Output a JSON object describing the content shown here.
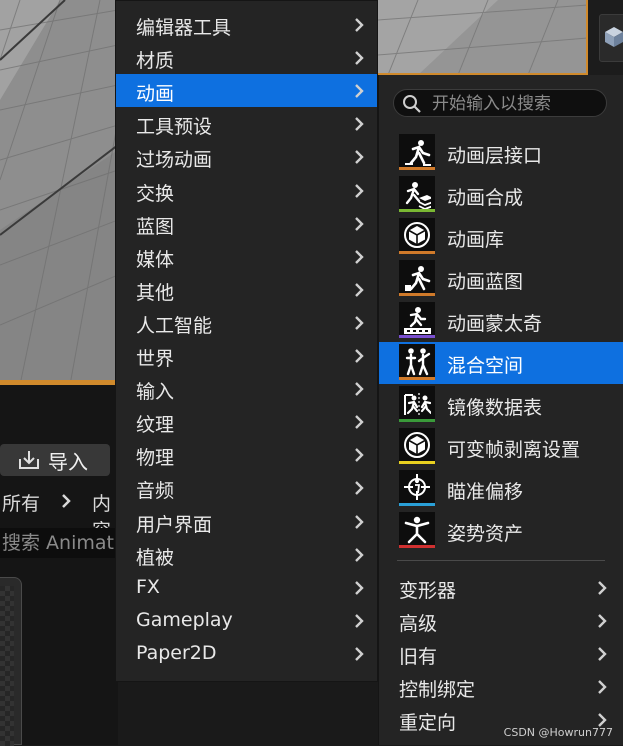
{
  "colors": {
    "selection": "#0e70e0",
    "menu_background": "#242424",
    "viewport_border": "#d08a2c"
  },
  "background": {
    "import_button": {
      "label": "导入",
      "icon": "import-icon"
    },
    "breadcrumb": {
      "root": "所有",
      "separator": "chevron-right-icon",
      "next": "内容"
    },
    "search": {
      "value": "搜索 Animation"
    }
  },
  "main_menu": {
    "items": [
      {
        "label": "编辑器工具",
        "selected": false
      },
      {
        "label": "材质",
        "selected": false
      },
      {
        "label": "动画",
        "selected": true
      },
      {
        "label": "工具预设",
        "selected": false
      },
      {
        "label": "过场动画",
        "selected": false
      },
      {
        "label": "交换",
        "selected": false
      },
      {
        "label": "蓝图",
        "selected": false
      },
      {
        "label": "媒体",
        "selected": false
      },
      {
        "label": "其他",
        "selected": false
      },
      {
        "label": "人工智能",
        "selected": false
      },
      {
        "label": "世界",
        "selected": false
      },
      {
        "label": "输入",
        "selected": false
      },
      {
        "label": "纹理",
        "selected": false
      },
      {
        "label": "物理",
        "selected": false
      },
      {
        "label": "音频",
        "selected": false
      },
      {
        "label": "用户界面",
        "selected": false
      },
      {
        "label": "植被",
        "selected": false
      },
      {
        "label": "FX",
        "selected": false
      },
      {
        "label": "Gameplay",
        "selected": false
      },
      {
        "label": "Paper2D",
        "selected": false
      }
    ]
  },
  "sub_menu": {
    "search_placeholder": "开始输入以搜索",
    "assets": [
      {
        "label": "动画层接口",
        "icon": "animation-layer-interface-icon",
        "color": "#d07a2a",
        "selected": false
      },
      {
        "label": "动画合成",
        "icon": "animation-composite-icon",
        "color": "#7ab833",
        "selected": false
      },
      {
        "label": "动画库",
        "icon": "animation-library-icon",
        "color": "#d07a2a",
        "selected": false
      },
      {
        "label": "动画蓝图",
        "icon": "animation-blueprint-icon",
        "color": "#d07a2a",
        "selected": false
      },
      {
        "label": "动画蒙太奇",
        "icon": "animation-montage-icon",
        "color": "#7a4fd0",
        "selected": false
      },
      {
        "label": "混合空间",
        "icon": "blend-space-icon",
        "color": "#d07a2a",
        "selected": true
      },
      {
        "label": "镜像数据表",
        "icon": "mirror-data-table-icon",
        "color": "#3a9a3a",
        "selected": false
      },
      {
        "label": "可变帧剥离设置",
        "icon": "variable-frame-stripping-icon",
        "color": "#e8d020",
        "selected": false
      },
      {
        "label": "瞄准偏移",
        "icon": "aim-offset-icon",
        "color": "#2aa0d8",
        "selected": false
      },
      {
        "label": "姿势资产",
        "icon": "pose-asset-icon",
        "color": "#d03030",
        "selected": false
      }
    ],
    "categories": [
      {
        "label": "变形器"
      },
      {
        "label": "高级"
      },
      {
        "label": "旧有"
      },
      {
        "label": "控制绑定"
      },
      {
        "label": "重定向"
      }
    ]
  },
  "watermark": "CSDN @Howrun777"
}
